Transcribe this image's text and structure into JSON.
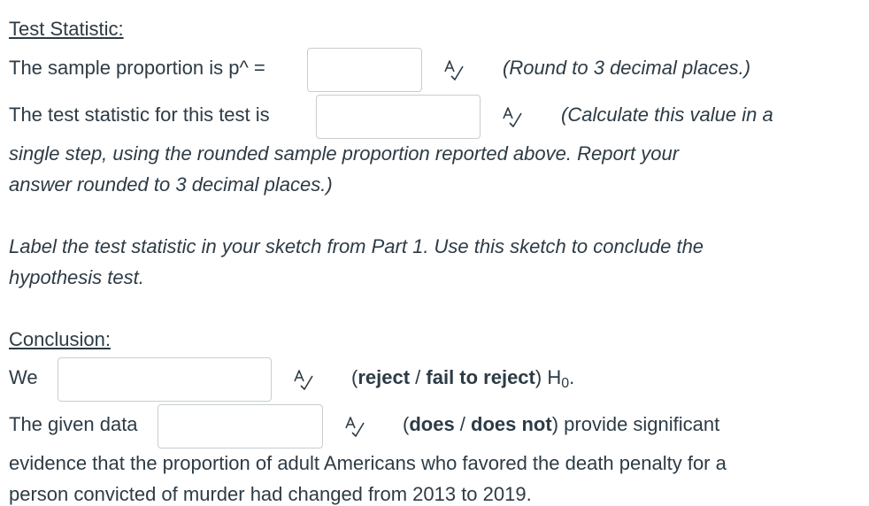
{
  "test_statistic": {
    "heading": "Test Statistic:",
    "sample_prop_label": "The sample proportion is p^ =",
    "sample_prop_value": "",
    "sample_prop_hint": "(Round to 3 decimal places.)",
    "stat_label": "The test statistic for this test is",
    "stat_value": "",
    "stat_hint_1": "(Calculate this value in a",
    "stat_hint_2": "single step, using the rounded sample proportion reported above.  Report your",
    "stat_hint_3": "answer rounded to 3 decimal places.)"
  },
  "instruction": {
    "line1": "Label the test statistic in your sketch from Part 1.  Use this sketch to conclude the",
    "line2": "hypothesis test."
  },
  "conclusion": {
    "heading": "Conclusion:",
    "we_label": "We",
    "we_value": "",
    "reject_opt": "reject",
    "sep1": " / ",
    "fail_opt": "fail to reject",
    "h0_h": "H",
    "h0_sub": "0",
    "data_label": "The given data",
    "data_value": "",
    "does_opt": "does",
    "sep2": " / ",
    "does_not_opt": "does not",
    "data_tail": "provide significant",
    "evidence_line1": "evidence that the proportion of adult Americans who favored the death penalty for a",
    "evidence_line2": "person convicted of murder had changed from 2013 to 2019."
  }
}
